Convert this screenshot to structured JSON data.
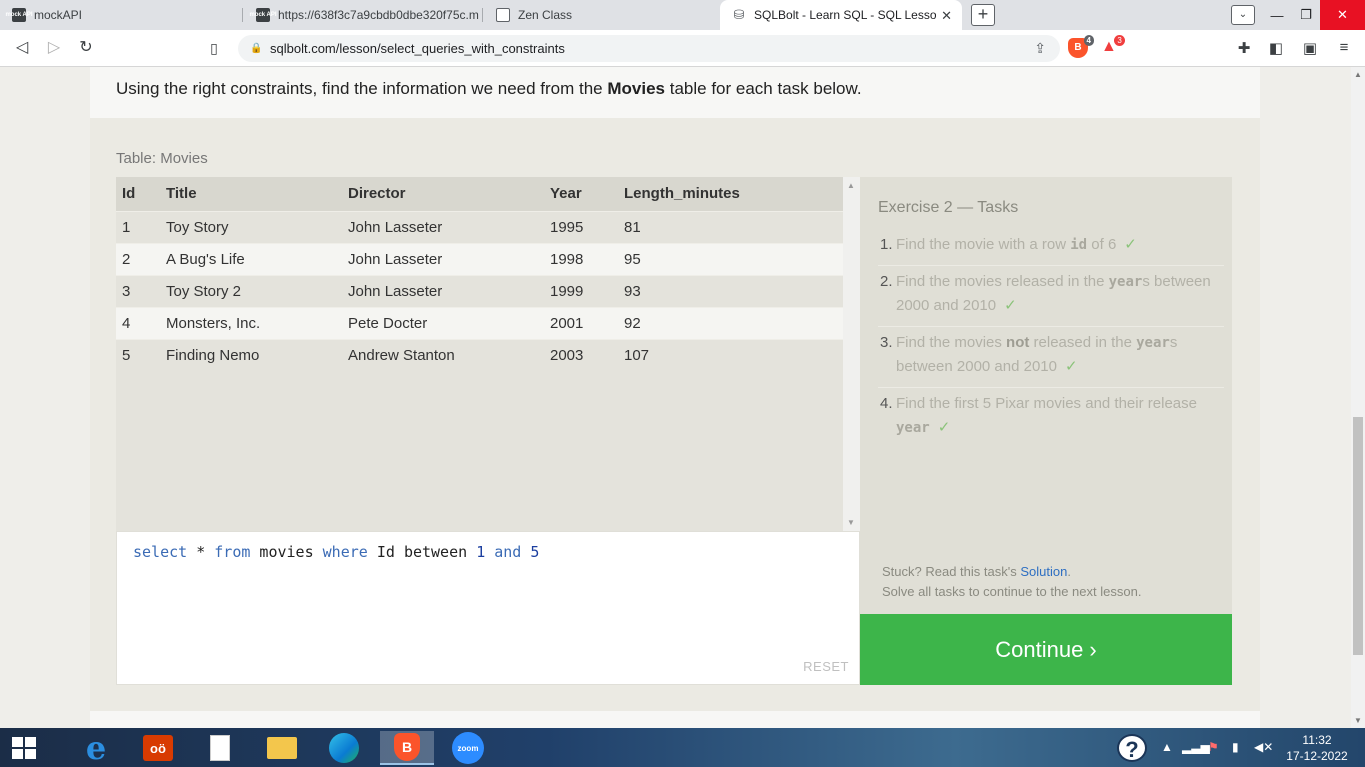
{
  "browser": {
    "tabs": [
      {
        "title": "mockAPI",
        "favicon": "mock-api-icon",
        "active": false
      },
      {
        "title": "https://638f3c7a9cbdb0dbe320f75c.m",
        "favicon": "mock-api-icon",
        "active": false
      },
      {
        "title": "Zen Class",
        "favicon": "zen-class-icon",
        "active": false
      },
      {
        "title": "SQLBolt - Learn SQL - SQL Lesson",
        "favicon": "database-icon",
        "active": true
      }
    ],
    "mock_favicon_text": "mock API",
    "url": "sqlbolt.com/lesson/select_queries_with_constraints",
    "brave_shield_count": "4",
    "rewards_count": "3"
  },
  "lesson": {
    "intro_before": "Using the right constraints, find the information we need from the ",
    "intro_bold": "Movies",
    "intro_after": " table for each task below."
  },
  "table": {
    "caption": "Table: Movies",
    "columns": [
      "Id",
      "Title",
      "Director",
      "Year",
      "Length_minutes"
    ],
    "rows": [
      [
        "1",
        "Toy Story",
        "John Lasseter",
        "1995",
        "81"
      ],
      [
        "2",
        "A Bug's Life",
        "John Lasseter",
        "1998",
        "95"
      ],
      [
        "3",
        "Toy Story 2",
        "John Lasseter",
        "1999",
        "93"
      ],
      [
        "4",
        "Monsters, Inc.",
        "Pete Docter",
        "2001",
        "92"
      ],
      [
        "5",
        "Finding Nemo",
        "Andrew Stanton",
        "2003",
        "107"
      ]
    ]
  },
  "editor": {
    "code": {
      "select": "select",
      "star": " * ",
      "from": "from",
      "table": " movies ",
      "where": "where",
      "column": " Id ",
      "between": "between",
      "low": "1",
      "and": "and",
      "high": "5"
    },
    "reset_label": "RESET"
  },
  "tasks": {
    "title": "Exercise 2 — Tasks",
    "items": [
      {
        "num": "1.",
        "parts": [
          "Find the movie with a row ",
          "id",
          " of 6"
        ]
      },
      {
        "num": "2.",
        "parts": [
          "Find the movies released in the ",
          "year",
          "s between 2000 and 2010"
        ]
      },
      {
        "num": "3.",
        "parts": [
          "Find the movies ",
          "not",
          " released in the ",
          "year",
          "s between 2000 and 2010"
        ]
      },
      {
        "num": "4.",
        "parts": [
          "Find the first 5 Pixar movies and their release ",
          "year"
        ]
      }
    ],
    "check": "✓",
    "stuck_before": "Stuck? Read this task's ",
    "stuck_link": "Solution",
    "stuck_after": ".",
    "solve_all": "Solve all tasks to continue to the next lesson."
  },
  "continue_label": "Continue ›",
  "taskbar": {
    "zoom_label": "zoom",
    "office_label": "oӧ",
    "time": "11:32",
    "date": "17-12-2022"
  },
  "colors": {
    "continue": "#3db54a",
    "link": "#2e6fc2",
    "check": "#8bc37a",
    "keyword": "#3b6bb5"
  }
}
